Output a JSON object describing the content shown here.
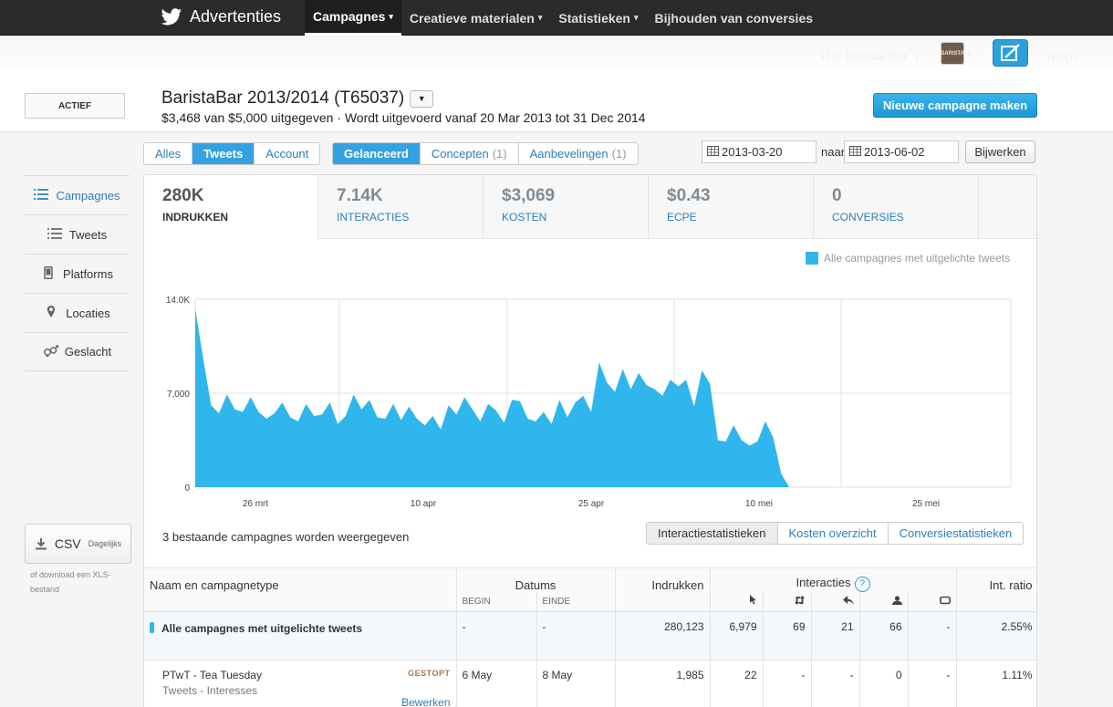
{
  "app": {
    "brand": "Advertenties"
  },
  "nav": [
    {
      "label": "Campagnes",
      "active": true,
      "caret": true
    },
    {
      "label": "Creatieve materialen",
      "active": false,
      "caret": true
    },
    {
      "label": "Statistieken",
      "active": false,
      "caret": true
    },
    {
      "label": "Bijhouden van conversies",
      "active": false,
      "caret": false
    }
  ],
  "account": {
    "name": "The Barista Bar",
    "avatar_text": "BARISTA",
    "help": "Help?"
  },
  "campaign": {
    "status": "ACTIEF",
    "title": "BaristaBar 2013/2014 (T65037)",
    "subtitle": "$3,468 van $5,000 uitgegeven · Wordt uitgevoerd vanaf 20 Mar 2013 tot 31 Dec 2014",
    "new_button": "Nieuwe campagne maken"
  },
  "filters": {
    "type": [
      {
        "label": "Alles",
        "active": false
      },
      {
        "label": "Tweets",
        "active": true
      },
      {
        "label": "Account",
        "active": false
      }
    ],
    "state": [
      {
        "label": "Gelanceerd",
        "count": "",
        "active": true
      },
      {
        "label": "Concepten",
        "count": "(1)",
        "active": false
      },
      {
        "label": "Aanbevelingen",
        "count": "(1)",
        "active": false
      }
    ],
    "date_from": "2013-03-20",
    "to_label": "naar",
    "date_to": "2013-06-02",
    "update": "Bijwerken"
  },
  "sidebar": {
    "items": [
      {
        "label": "Campagnes",
        "icon": "list-icon",
        "active": true
      },
      {
        "label": "Tweets",
        "icon": "list-icon",
        "active": false
      },
      {
        "label": "Platforms",
        "icon": "phone-icon",
        "active": false
      },
      {
        "label": "Locaties",
        "icon": "pin-icon",
        "active": false
      },
      {
        "label": "Geslacht",
        "icon": "gender-icon",
        "active": false
      }
    ],
    "csv_label": "CSV",
    "csv_small": "Dagelijks",
    "csv_note": "of download een XLS-bestand"
  },
  "metrics": [
    {
      "value": "280K",
      "label": "INDRUKKEN",
      "active": true
    },
    {
      "value": "7.14K",
      "label": "INTERACTIES",
      "active": false
    },
    {
      "value": "$3,069",
      "label": "KOSTEN",
      "active": false
    },
    {
      "value": "$0.43",
      "label": "ECPE",
      "active": false
    },
    {
      "value": "0",
      "label": "CONVERSIES",
      "active": false
    }
  ],
  "chart_data": {
    "type": "area",
    "series": [
      {
        "name": "Alle campagnes met uitgelichte tweets",
        "color": "#2fb6ec",
        "values": [
          13300,
          9600,
          6100,
          5500,
          6900,
          5800,
          5600,
          6700,
          5600,
          5100,
          5500,
          6300,
          5200,
          4900,
          6200,
          5300,
          5400,
          6300,
          4700,
          5300,
          6900,
          5800,
          6500,
          5200,
          5100,
          6200,
          5000,
          6000,
          5100,
          4600,
          5300,
          4300,
          6100,
          5400,
          6700,
          5800,
          4900,
          6200,
          5700,
          4800,
          6500,
          6400,
          5100,
          4900,
          5600,
          4700,
          6500,
          5200,
          6300,
          6800,
          5600,
          9300,
          7800,
          7100,
          8800,
          7300,
          8500,
          7600,
          7300,
          6800,
          8000,
          7500,
          8000,
          6000,
          8700,
          7700,
          3500,
          3400,
          4600,
          3500,
          3100,
          3400,
          4900,
          3700,
          1000,
          0,
          0,
          0,
          0,
          0,
          0,
          0,
          0,
          0,
          0,
          0,
          0,
          0,
          0,
          0,
          0,
          0,
          0,
          0,
          0,
          0,
          0,
          0,
          0,
          0,
          0,
          0,
          0,
          0
        ]
      }
    ],
    "ylim": [
      0,
      14000
    ],
    "y_ticks": [
      "14.0K",
      "7,000",
      "0"
    ],
    "x_ticks": [
      "26 mrt",
      "10 apr",
      "25 apr",
      "10 mei",
      "25 mei"
    ],
    "legend": "top-right",
    "grid": true
  },
  "table_caption": "3 bestaande campagnes worden weergegeven",
  "table_tabs": [
    "Interactiestatistieken",
    "Kosten overzicht",
    "Conversiestatistieken"
  ],
  "table": {
    "headers": {
      "name": "Naam en campagnetype",
      "dates": "Datums",
      "begin": "BEGIN",
      "end": "EINDE",
      "impressions": "Indrukken",
      "interactions": "Interacties",
      "ratio": "Int. ratio"
    },
    "total": {
      "name": "Alle campagnes met uitgelichte tweets",
      "begin": "-",
      "end": "-",
      "impressions": "280,123",
      "clicks": "6,979",
      "retweets": "69",
      "replies": "21",
      "follows": "66",
      "cards": "-",
      "ratio": "2.55%"
    },
    "rows": [
      {
        "name": "PTwT - Tea Tuesday",
        "type": "Tweets - Interesses",
        "status": "GESTOPT",
        "edit": "Bewerken",
        "begin": "6 May",
        "end": "8 May",
        "impressions": "1,985",
        "clicks": "22",
        "retweets": "-",
        "replies": "-",
        "follows": "0",
        "cards": "-",
        "ratio": "1.11%"
      }
    ]
  }
}
